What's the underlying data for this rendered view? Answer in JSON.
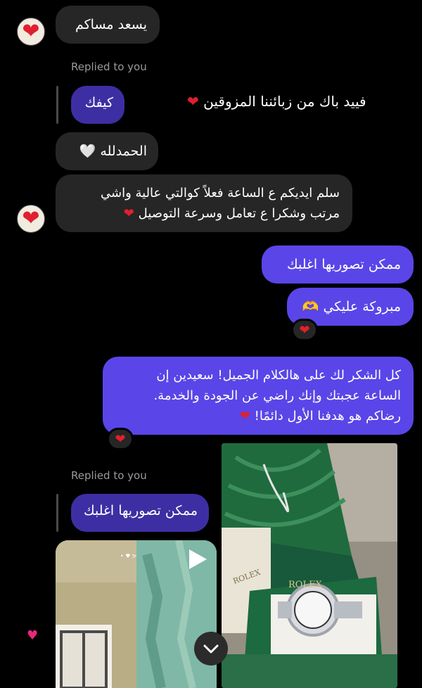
{
  "messages": {
    "m1": "يسعد مساكم",
    "replied_1": "Replied to you",
    "quoted_1": "كيفك",
    "story_caption": "فييد باك من زبائننا المزوقين",
    "m2": "الحمدلله 🤍",
    "m3_line1": "سلم ايديكم ع الساعة فعلاً كوالتي عالية واشي",
    "m3_line2": "مرتب وشكرا ع تعامل وسرعة التوصيل",
    "out1": "ممكن تصوريها اغلبك",
    "out2": "مبروكة عليكي 🫶",
    "out3_line1": "كل الشكر لك على هالكلام الجميل! سعيدين إن",
    "out3_line2": "الساعة عجبتك وإنك راضي عن الجودة والخدمة.",
    "out3_line3": "رضاكم هو هدفنا الأول دائمًا!",
    "replied_2": "Replied to you",
    "quoted_2": "ممكن تصوريها اغلبك"
  },
  "video_sticker": "• ♥ ᕗ",
  "photo_brand_text": "ROLEX",
  "icons": {
    "heart": "heart-icon",
    "play": "play-icon",
    "scroll_down": "chevron-down-icon"
  },
  "colors": {
    "background": "#000000",
    "incoming_bubble": "#262626",
    "outgoing_bubble": "#5a45e8",
    "quoted_bubble": "#3d2fa3",
    "reaction_heart": "#e0202e"
  }
}
